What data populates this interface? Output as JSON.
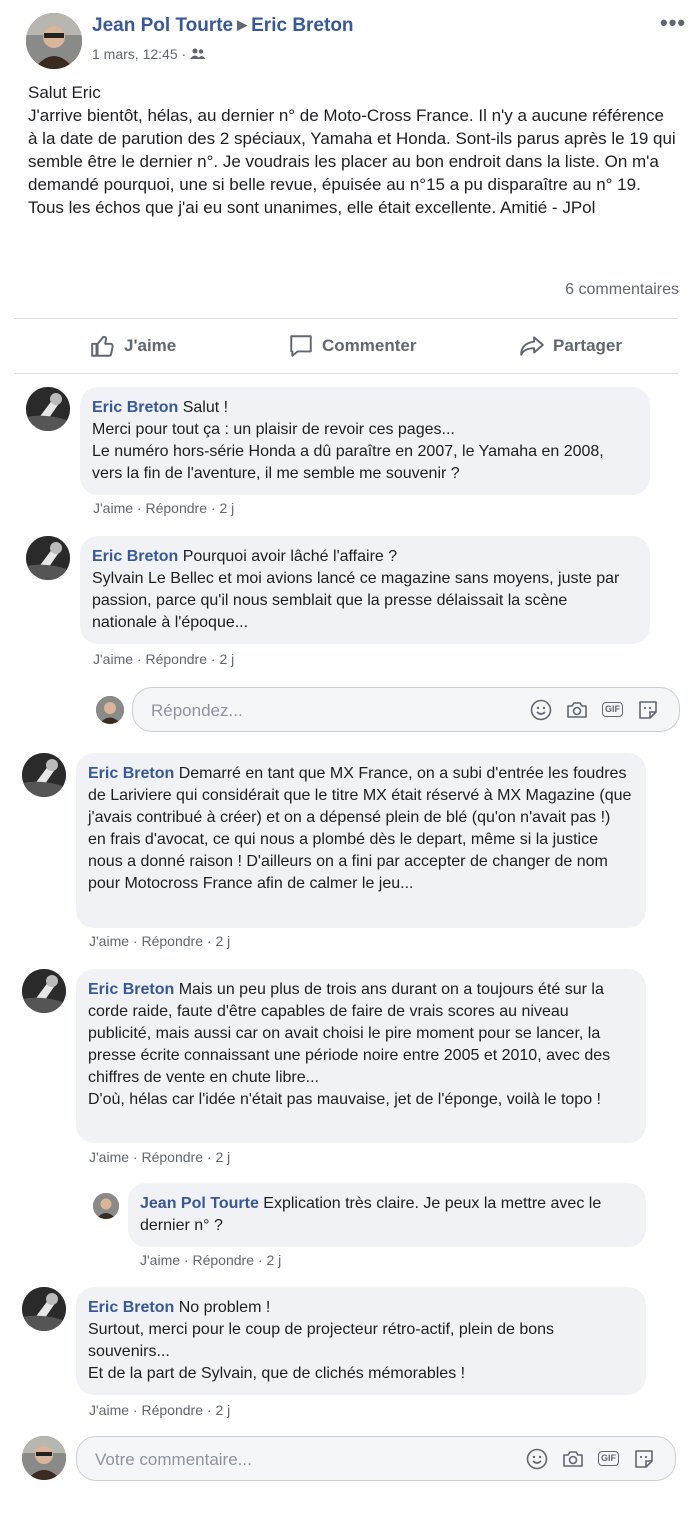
{
  "post": {
    "author": "Jean Pol Tourte",
    "target": "Eric Breton",
    "timestamp": "1 mars, 12:45",
    "audience_icon": "friends-icon",
    "body": "Salut Eric\nJ'arrive bientôt, hélas, au dernier n° de Moto-Cross France. Il n'y a aucune référence à la date de parution des 2 spéciaux, Yamaha et Honda. Sont-ils parus après le 19 qui semble être le dernier n°. Je voudrais les placer au bon endroit dans la liste. On m'a demandé pourquoi, une si belle revue, épuisée au n°15 a pu disparaître au n° 19. Tous les échos que j'ai eu sont unanimes, elle était excellente. Amitié - JPol",
    "comment_count": "6 commentaires"
  },
  "actions": {
    "like": "J'aime",
    "comment": "Commenter",
    "share": "Partager"
  },
  "comments": [
    {
      "author": "Eric Breton",
      "text": " Salut !\nMerci pour tout ça : un plaisir de revoir ces pages...\nLe numéro hors-série Honda a dû paraître en 2007, le Yamaha en 2008, vers la fin de l'aventure, il me semble me souvenir ?",
      "like": "J'aime",
      "reply": "Répondre",
      "time": "2 j"
    },
    {
      "author": "Eric Breton",
      "text": " Pourquoi avoir lâché l'affaire ?\nSylvain Le Bellec et moi avions lancé ce magazine sans moyens, juste par passion, parce qu'il nous semblait que la presse délaissait la scène nationale à l'époque...",
      "like": "J'aime",
      "reply": "Répondre",
      "time": "2 j"
    },
    {
      "author": "Eric Breton",
      "text": " Demarré en tant que MX France, on a subi d'entrée les foudres de Lariviere qui considérait que le titre MX était réservé à MX Magazine (que j'avais contribué à créer) et on a dépensé plein de blé (qu'on n'avait pas !) en frais d'avocat, ce qui nous a plombé dès le depart, même si la justice nous a donné raison ! D'ailleurs on a fini par accepter de changer de nom pour Motocross France afin de calmer le jeu...",
      "like": "J'aime",
      "reply": "Répondre",
      "time": "2 j"
    },
    {
      "author": "Eric Breton",
      "text": " Mais un peu plus de trois ans durant on a toujours été sur la corde raide, faute d'être capables de faire de vrais scores au niveau publicité, mais aussi car on avait choisi le pire moment pour se lancer, la presse écrite connaissant une période noire entre 2005 et 2010, avec des chiffres de vente en chute libre...\nD'où, hélas car l'idée n'était pas mauvaise, jet de l'éponge, voilà le topo !",
      "like": "J'aime",
      "reply": "Répondre",
      "time": "2 j"
    },
    {
      "author": "Jean Pol Tourte",
      "text": " Explication très claire. Je peux la mettre avec le dernier n° ?",
      "like": "J'aime",
      "reply": "Répondre",
      "time": "2 j"
    },
    {
      "author": "Eric Breton",
      "text": " No problem !\nSurtout, merci pour le coup de projecteur rétro-actif, plein de bons souvenirs...\nEt de la part de Sylvain, que de clichés mémorables !",
      "like": "J'aime",
      "reply": "Répondre",
      "time": "2 j"
    }
  ],
  "reply_input": {
    "placeholder": "Répondez..."
  },
  "comment_input": {
    "placeholder": "Votre commentaire..."
  },
  "input_icons": [
    "emoji-icon",
    "camera-icon",
    "gif-icon",
    "sticker-icon"
  ],
  "gif_label": "GIF",
  "colors": {
    "link": "#385898",
    "meta": "#606770",
    "bubble": "#f0f2f5"
  }
}
